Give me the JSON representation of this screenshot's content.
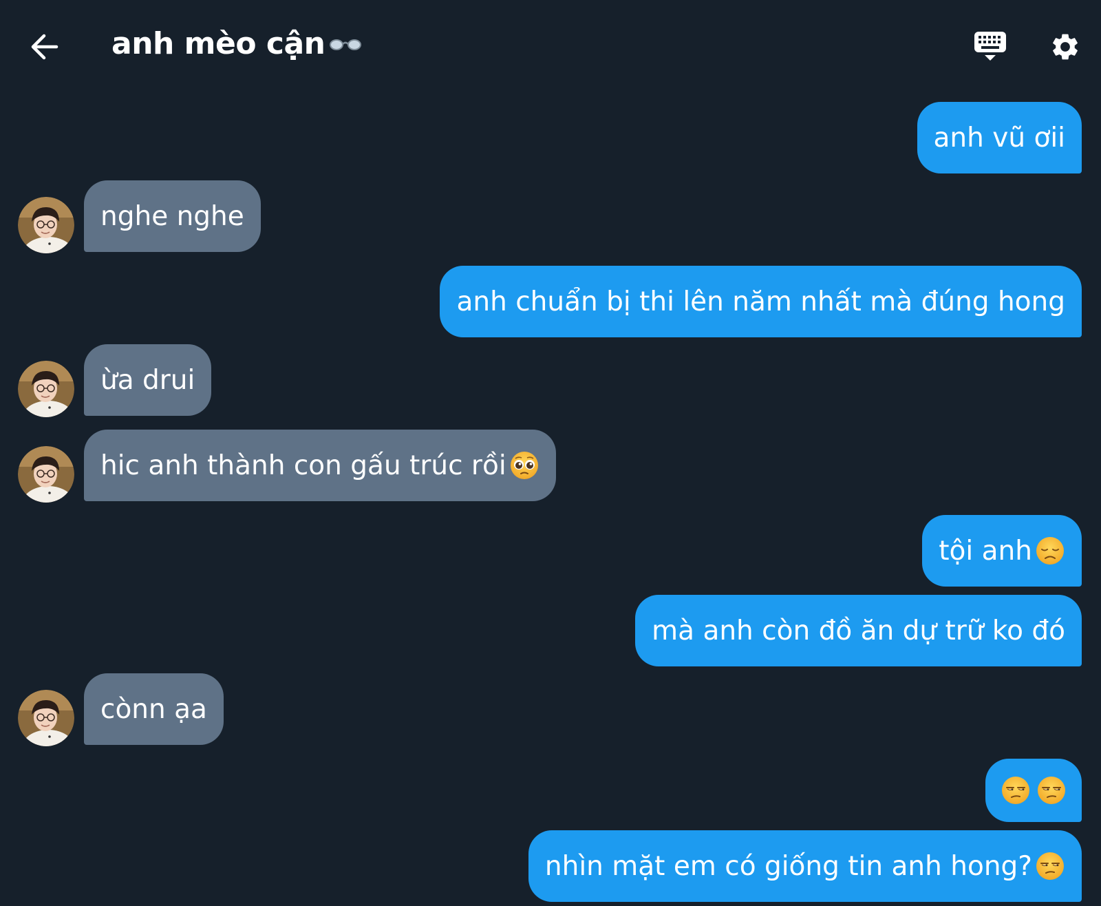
{
  "header": {
    "title": "anh mèo cận",
    "title_emoji": "glasses-icon"
  },
  "messages": [
    {
      "dir": "out",
      "text": "anh vũ ơii"
    },
    {
      "dir": "in",
      "text": "nghe nghe"
    },
    {
      "dir": "out",
      "text": "anh chuẩn bị thi lên năm nhất mà đúng hong"
    },
    {
      "dir": "in",
      "text": "ừa drui"
    },
    {
      "dir": "in",
      "text": "hic anh thành con gấu trúc rồi",
      "emoji": "pleading-face-emoji"
    },
    {
      "dir": "out",
      "text": "tội anh",
      "emoji": "disappointed-face-emoji"
    },
    {
      "dir": "out",
      "text": "mà anh còn đồ ăn dự trữ ko đó"
    },
    {
      "dir": "in",
      "text": "cònn ạa"
    },
    {
      "dir": "out",
      "text": "",
      "emoji": "unamused-face-emoji x2"
    },
    {
      "dir": "out",
      "text": "nhìn mặt em có giống tin anh hong?",
      "emoji": "unamused-face-emoji"
    }
  ],
  "colors": {
    "background": "#16202b",
    "outgoing_bubble": "#1d9bf0",
    "incoming_bubble": "#5f7287"
  }
}
